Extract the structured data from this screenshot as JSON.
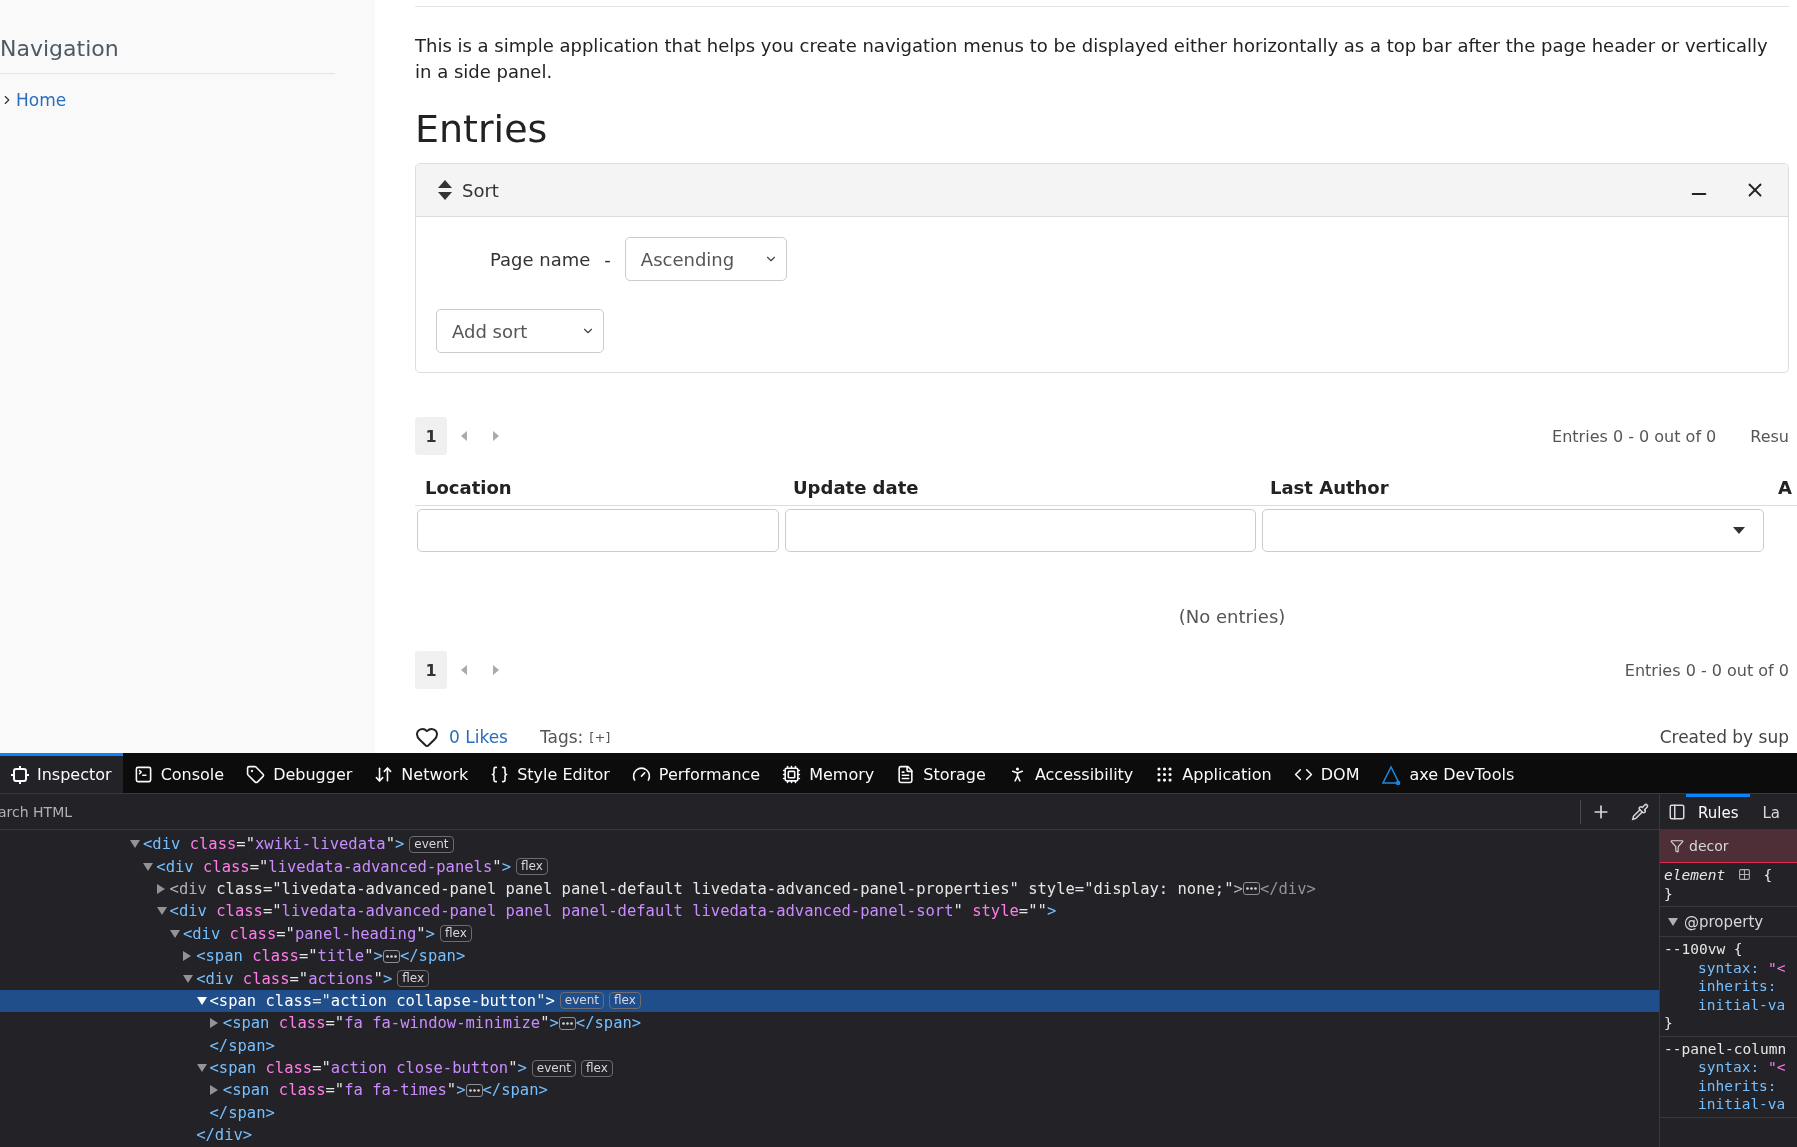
{
  "sidebar": {
    "title": "Navigation",
    "items": [
      {
        "label": "Home"
      }
    ]
  },
  "content": {
    "description": "This is a simple application that helps you create navigation menus to be displayed either horizontally as a top bar after the page header or vertically in a side panel.",
    "heading": "Entries",
    "sort_panel": {
      "title": "Sort",
      "sorts": [
        {
          "field": "Page name",
          "separator": "-",
          "order": "Ascending"
        }
      ],
      "add_sort": "Add sort"
    },
    "pagination_top": {
      "pages": [
        {
          "label": "1",
          "selected": true
        }
      ],
      "summary": "Entries 0 - 0 out of 0",
      "extra": "Resu"
    },
    "table": {
      "columns": [
        {
          "label": "Location",
          "kind": "text"
        },
        {
          "label": "Update date",
          "kind": "text"
        },
        {
          "label": "Last Author",
          "kind": "select"
        },
        {
          "label": "A"
        }
      ],
      "empty_message": "(No entries)"
    },
    "pagination_bottom": {
      "pages": [
        {
          "label": "1",
          "selected": true
        }
      ],
      "summary": "Entries 0 - 0 out of 0"
    },
    "footer": {
      "likes": "0 Likes",
      "tags_label": "Tags:",
      "tags_add": "[+]",
      "created_by": "Created by sup"
    }
  },
  "devtools": {
    "tabs": [
      {
        "label": "Inspector",
        "selected": true
      },
      {
        "label": "Console",
        "selected": false
      },
      {
        "label": "Debugger",
        "selected": false
      },
      {
        "label": "Network",
        "selected": false
      },
      {
        "label": "Style Editor",
        "selected": false
      },
      {
        "label": "Performance",
        "selected": false
      },
      {
        "label": "Memory",
        "selected": false
      },
      {
        "label": "Storage",
        "selected": false
      },
      {
        "label": "Accessibility",
        "selected": false
      },
      {
        "label": "Application",
        "selected": false
      },
      {
        "label": "DOM",
        "selected": false
      },
      {
        "label": "axe DevTools",
        "selected": false
      }
    ],
    "search": {
      "placeholder": "arch HTML"
    },
    "tree": [
      {
        "open": "<div",
        "attrs": [
          "class=\"xwiki-livedata\""
        ],
        "end": ">",
        "badges": [
          "event"
        ],
        "expanded": true,
        "selected": false,
        "dimmed": false,
        "children": [
          {
            "open": "<div",
            "attrs": [
              "class=\"livedata-advanced-panels\""
            ],
            "end": ">",
            "badges": [
              "flex"
            ],
            "expanded": true,
            "selected": false,
            "dimmed": false,
            "children": [
              {
                "open": "<div",
                "attrs": [
                  "class=\"livedata-advanced-panel panel panel-default livedata-advanced-panel-properties\"",
                  "style=\"display: none;\""
                ],
                "end": ">",
                "expanded": false,
                "selected": false,
                "dimmed": true,
                "close": "</div>"
              },
              {
                "open": "<div",
                "attrs": [
                  "class=\"livedata-advanced-panel panel panel-default livedata-advanced-panel-sort\"",
                  "style=\"\""
                ],
                "end": ">",
                "expanded": true,
                "selected": false,
                "dimmed": false,
                "children": [
                  {
                    "open": "<div",
                    "attrs": [
                      "class=\"panel-heading\""
                    ],
                    "end": ">",
                    "badges": [
                      "flex"
                    ],
                    "expanded": true,
                    "selected": false,
                    "dimmed": false,
                    "children": [
                      {
                        "open": "<span",
                        "attrs": [
                          "class=\"title\""
                        ],
                        "end": ">",
                        "expanded": false,
                        "selected": false,
                        "dimmed": false,
                        "close": "</span>"
                      },
                      {
                        "open": "<div",
                        "attrs": [
                          "class=\"actions\""
                        ],
                        "end": ">",
                        "badges": [
                          "flex"
                        ],
                        "expanded": true,
                        "selected": false,
                        "dimmed": false,
                        "close": "</div>",
                        "children": [
                          {
                            "open": "<span",
                            "attrs": [
                              "class=\"action collapse-button\""
                            ],
                            "end": ">",
                            "badges": [
                              "event",
                              "flex"
                            ],
                            "expanded": true,
                            "selected": true,
                            "dimmed": false,
                            "close": "</span>",
                            "children": [
                              {
                                "open": "<span",
                                "attrs": [
                                  "class=\"fa fa-window-minimize\""
                                ],
                                "end": ">",
                                "expanded": false,
                                "selected": false,
                                "dimmed": false,
                                "close": "</span>"
                              }
                            ]
                          },
                          {
                            "open": "<span",
                            "attrs": [
                              "class=\"action close-button\""
                            ],
                            "end": ">",
                            "badges": [
                              "event",
                              "flex"
                            ],
                            "expanded": true,
                            "selected": false,
                            "dimmed": false,
                            "close": "</span>",
                            "children": [
                              {
                                "open": "<span",
                                "attrs": [
                                  "class=\"fa fa-times\""
                                ],
                                "end": ">",
                                "expanded": false,
                                "selected": false,
                                "dimmed": false,
                                "close": "</span>"
                              }
                            ]
                          }
                        ]
                      }
                    ]
                  }
                ]
              }
            ]
          }
        ]
      }
    ],
    "rules_panel": {
      "tabs": [
        {
          "label": "Rules",
          "selected": true
        },
        {
          "label": "La",
          "selected": false
        }
      ],
      "filter": {
        "value": "decor",
        "no_match": true
      },
      "element_rule": {
        "selector": "element",
        "open": "{",
        "close": "}"
      },
      "at_rule": {
        "label": "@property",
        "expanded": true,
        "rules": [
          {
            "selector": "--100vw {",
            "declarations": [
              {
                "name": "syntax:",
                "value": "\"<"
              },
              {
                "name": "inherits:"
              },
              {
                "name": "initial-va"
              }
            ],
            "close": "}"
          },
          {
            "selector": "--panel-column",
            "declarations": [
              {
                "name": "syntax:",
                "value": "\"<"
              },
              {
                "name": "inherits:"
              },
              {
                "name": "initial-va"
              }
            ]
          }
        ]
      }
    }
  }
}
